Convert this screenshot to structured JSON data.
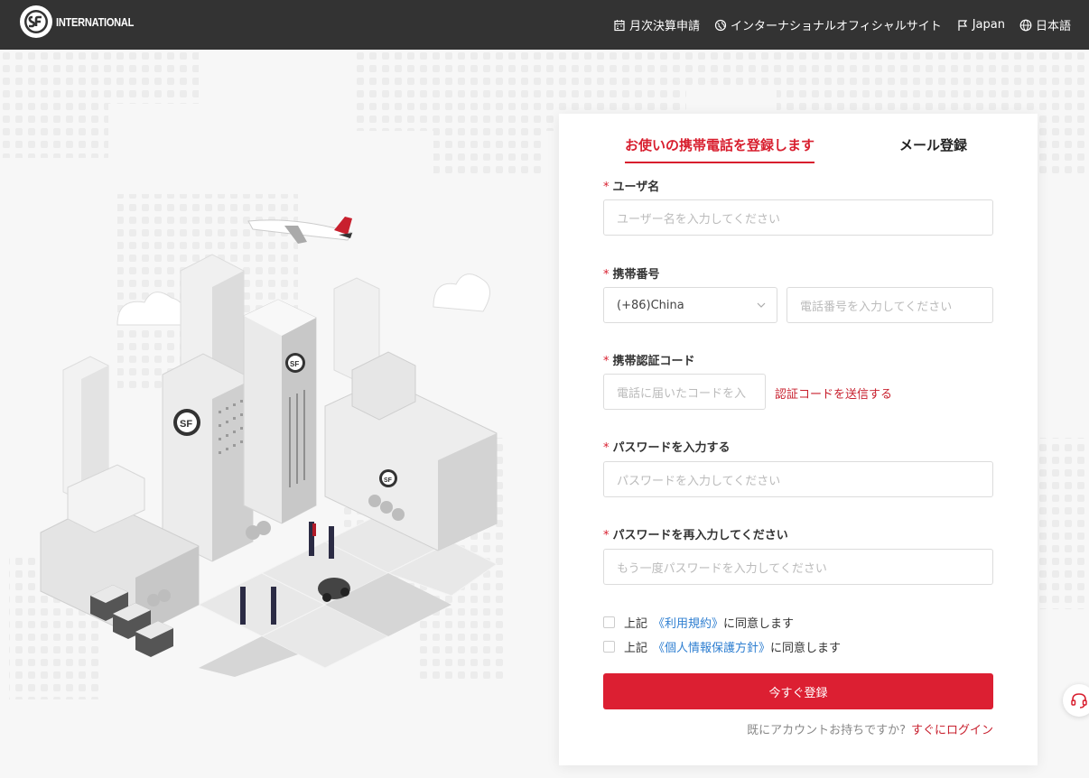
{
  "header": {
    "logo_text": "INTERNATIONAL",
    "nav": [
      {
        "label": "月次決算申請",
        "icon": "calendar-icon"
      },
      {
        "label": "インターナショナルオフィシャルサイト",
        "icon": "globe-site-icon"
      },
      {
        "label": "Japan",
        "icon": "flag-icon"
      },
      {
        "label": "日本語",
        "icon": "language-globe-icon"
      }
    ]
  },
  "form": {
    "tabs": {
      "active": "お使いの携帯電話を登録します",
      "other": "メール登録"
    },
    "req_mark": "*",
    "username": {
      "label": "ユーザ名",
      "placeholder": "ユーザー名を入力してください"
    },
    "phone": {
      "label": "携帯番号",
      "country": "(+86)China",
      "placeholder": "電話番号を入力してください"
    },
    "code": {
      "label": "携帯認証コード",
      "placeholder": "電話に届いたコードを入",
      "send_label": "認証コードを送信する"
    },
    "password": {
      "label": "パスワードを入力する",
      "placeholder": "パスワードを入力してください"
    },
    "password_confirm": {
      "label": "パスワードを再入力してください",
      "placeholder": "もう一度パスワードを入力してください"
    },
    "agreements": [
      {
        "prefix": "上記",
        "link": "《利用規約》",
        "suffix": "に同意します"
      },
      {
        "prefix": "上記",
        "link": "《個人情報保護方針》",
        "suffix": "に同意します"
      }
    ],
    "submit_label": "今すぐ登録",
    "login_prompt": "既にアカウントお持ちですか?",
    "login_link": "すぐにログイン"
  },
  "colors": {
    "brand_red": "#dc1f32",
    "header_bg": "#333333",
    "link_blue": "#2f7fd1"
  },
  "help": {
    "icon": "headset-icon"
  }
}
